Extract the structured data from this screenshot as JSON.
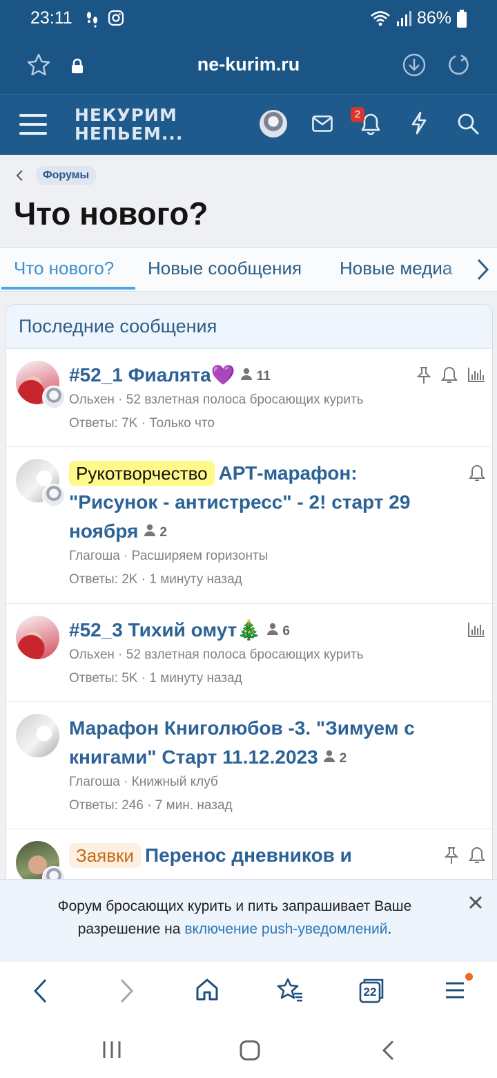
{
  "status_bar": {
    "time": "23:11",
    "battery": "86%"
  },
  "browser": {
    "url": "ne-kurim.ru"
  },
  "site": {
    "logo_line1": "НЕКУРИМ",
    "logo_line2": "НЕПЬЕМ...",
    "notification_count": "2"
  },
  "breadcrumb": {
    "label": "Форумы"
  },
  "page": {
    "title": "Что нового?"
  },
  "tabs": [
    {
      "label": "Что нового?",
      "active": true
    },
    {
      "label": "Новые сообщения",
      "active": false
    },
    {
      "label": "Новые медиа",
      "active": false
    }
  ],
  "panel": {
    "title": "Последние сообщения"
  },
  "threads": [
    {
      "prefix": "",
      "title": "#52_1 Фиалята💜",
      "participants": "11",
      "author": "Ольхен",
      "forum": "52 взлетная полоса бросающих курить",
      "replies": "Ответы: 7K",
      "time": "Только что"
    },
    {
      "prefix": "Рукотворчество",
      "title": "АРТ-марафон: \"Рисунок - антистресс\" - 2! старт 29 ноября",
      "participants": "2",
      "author": "Глагоша",
      "forum": "Расширяем горизонты",
      "replies": "Ответы: 2K",
      "time": "1 минуту назад"
    },
    {
      "prefix": "",
      "title": "#52_3 Тихий омут🎄",
      "participants": "6",
      "author": "Ольхен",
      "forum": "52 взлетная полоса бросающих курить",
      "replies": "Ответы: 5K",
      "time": "1 минуту назад"
    },
    {
      "prefix": "",
      "title": "Марафон Книголюбов -3. \"Зимуем с книгами\" Старт 11.12.2023",
      "participants": "2",
      "author": "Глагоша",
      "forum": "Книжный клуб",
      "replies": "Ответы: 246",
      "time": "7 мин. назад"
    },
    {
      "prefix": "Заявки",
      "title": "Перенос дневников и",
      "participants": "",
      "author": "",
      "forum": "",
      "replies": "",
      "time": ""
    }
  ],
  "push_notice": {
    "text_before": "Форум бросающих курить и пить запрашивает Ваше разрешение на",
    "link_text": "включение push-уведомлений",
    "text_after": "."
  },
  "browser_nav": {
    "tab_count": "22"
  },
  "colors": {
    "header": "#1b5586",
    "accent": "#2c6296",
    "tab_active": "#3b8fd3"
  }
}
